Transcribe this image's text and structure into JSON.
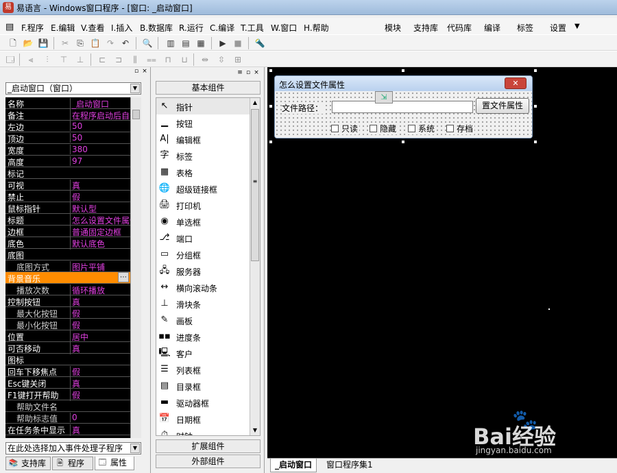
{
  "window": {
    "title": "易语言 - Windows窗口程序 - [窗口: _启动窗口]"
  },
  "menu": {
    "items": [
      "F.程序",
      "E.编辑",
      "V.查看",
      "I.插入",
      "B.数据库",
      "R.运行",
      "C.编译",
      "T.工具",
      "W.窗口",
      "H.帮助"
    ],
    "right_items": [
      "模块",
      "支持库",
      "代码库",
      "编译",
      "标签",
      "设置"
    ]
  },
  "left_panel": {
    "object_selector": "_启动窗口（窗口）",
    "properties": [
      {
        "k": "名称",
        "v": "_启动窗口"
      },
      {
        "k": "备注",
        "v": "在程序启动后自动"
      },
      {
        "k": "左边",
        "v": "50"
      },
      {
        "k": "顶边",
        "v": "50"
      },
      {
        "k": "宽度",
        "v": "380"
      },
      {
        "k": "高度",
        "v": "97"
      },
      {
        "k": "标记",
        "v": ""
      },
      {
        "k": "可视",
        "v": "真"
      },
      {
        "k": "禁止",
        "v": "假"
      },
      {
        "k": "鼠标指针",
        "v": "默认型"
      },
      {
        "k": "标题",
        "v": "怎么设置文件属性"
      },
      {
        "k": "边框",
        "v": "普通固定边框"
      },
      {
        "k": "底色",
        "v": "默认底色"
      },
      {
        "k": "底图",
        "v": ""
      },
      {
        "k": "底图方式",
        "v": "图片平铺",
        "sub": true
      },
      {
        "k": "背景音乐",
        "v": "",
        "selected": true
      },
      {
        "k": "播放次数",
        "v": "循环播放",
        "sub": true
      },
      {
        "k": "控制按钮",
        "v": "真"
      },
      {
        "k": "最大化按钮",
        "v": "假",
        "sub": true
      },
      {
        "k": "最小化按钮",
        "v": "假",
        "sub": true
      },
      {
        "k": "位置",
        "v": "居中"
      },
      {
        "k": "可否移动",
        "v": "真"
      },
      {
        "k": "图标",
        "v": ""
      },
      {
        "k": "回车下移焦点",
        "v": "假"
      },
      {
        "k": "Esc键关闭",
        "v": "真"
      },
      {
        "k": "F1键打开帮助",
        "v": "假"
      },
      {
        "k": "帮助文件名",
        "v": "",
        "sub": true
      },
      {
        "k": "帮助标志值",
        "v": "0",
        "sub": true
      },
      {
        "k": "在任务条中显示",
        "v": "真"
      }
    ],
    "event_selector": "在此处选择加入事件处理子程序",
    "tabs": [
      "支持库",
      "程序",
      "属性"
    ]
  },
  "components": {
    "header": "基本组件",
    "items": [
      {
        "icon": "↖",
        "label": "指针"
      },
      {
        "icon": "▁",
        "label": "按钮"
      },
      {
        "icon": "A|",
        "label": "编辑框"
      },
      {
        "icon": "字",
        "label": "标签"
      },
      {
        "icon": "▦",
        "label": "表格"
      },
      {
        "icon": "🌐",
        "label": "超级链接框"
      },
      {
        "icon": "🖨",
        "label": "打印机"
      },
      {
        "icon": "◉",
        "label": "单选框"
      },
      {
        "icon": "⎇",
        "label": "端口"
      },
      {
        "icon": "▭",
        "label": "分组框"
      },
      {
        "icon": "🖧",
        "label": "服务器"
      },
      {
        "icon": "↔",
        "label": "横向滚动条"
      },
      {
        "icon": "⊥",
        "label": "滑块条"
      },
      {
        "icon": "✎",
        "label": "画板"
      },
      {
        "icon": "▪▪",
        "label": "进度条"
      },
      {
        "icon": "🖳",
        "label": "客户"
      },
      {
        "icon": "☰",
        "label": "列表框"
      },
      {
        "icon": "▤",
        "label": "目录框"
      },
      {
        "icon": "▬",
        "label": "驱动器框"
      },
      {
        "icon": "📅",
        "label": "日期框"
      },
      {
        "icon": "⏱",
        "label": "时钟"
      }
    ],
    "ext_label": "扩展组件",
    "outer_label": "外部组件"
  },
  "dialog": {
    "title": "怎么设置文件属性",
    "path_label": "文件路径：",
    "button_label": "置文件属性",
    "checkboxes": [
      "只读",
      "隐藏",
      "系统",
      "存档"
    ]
  },
  "bottom_tabs": [
    "_启动窗口",
    "窗口程序集1"
  ],
  "watermark": {
    "brand": "Bai经验",
    "sub": "jingyan.baidu.com"
  }
}
